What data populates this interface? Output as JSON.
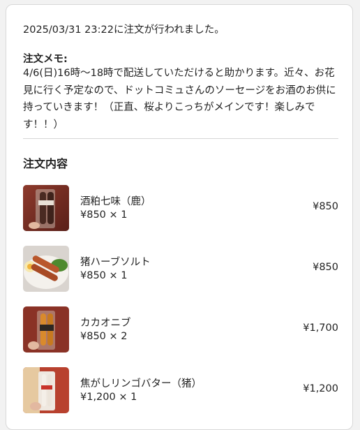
{
  "order": {
    "timestamp_text": "2025/03/31 23:22に注文が行われました。",
    "memo_label": "注文メモ:",
    "memo_text": "4/6(日)16時〜18時で配送していただけると助かります。近々、お花見に行く予定なので、ドットコミュさんのソーセージをお酒のお供に持っていきます！（正直、桜よりこっちがメインです！楽しみです！！）"
  },
  "items_section": {
    "title": "注文内容",
    "items": [
      {
        "name": "酒粕七味（鹿）",
        "qty": "¥850 × 1",
        "price": "¥850",
        "thumb": "sausage-pack-red-icon"
      },
      {
        "name": "猪ハーブソルト",
        "qty": "¥850 × 1",
        "price": "¥850",
        "thumb": "grilled-sausage-plate-icon"
      },
      {
        "name": "カカオニブ",
        "qty": "¥850 × 2",
        "price": "¥1,700",
        "thumb": "sausage-pack-orange-icon"
      },
      {
        "name": "焦がしリンゴバター（猪）",
        "qty": "¥1,200 × 1",
        "price": "¥1,200",
        "thumb": "sausage-pack-white-icon"
      }
    ]
  },
  "colors": {
    "card_bg": "#ffffff",
    "page_bg": "#f2f2f2",
    "text": "#222222",
    "divider": "#d6d6d6"
  }
}
